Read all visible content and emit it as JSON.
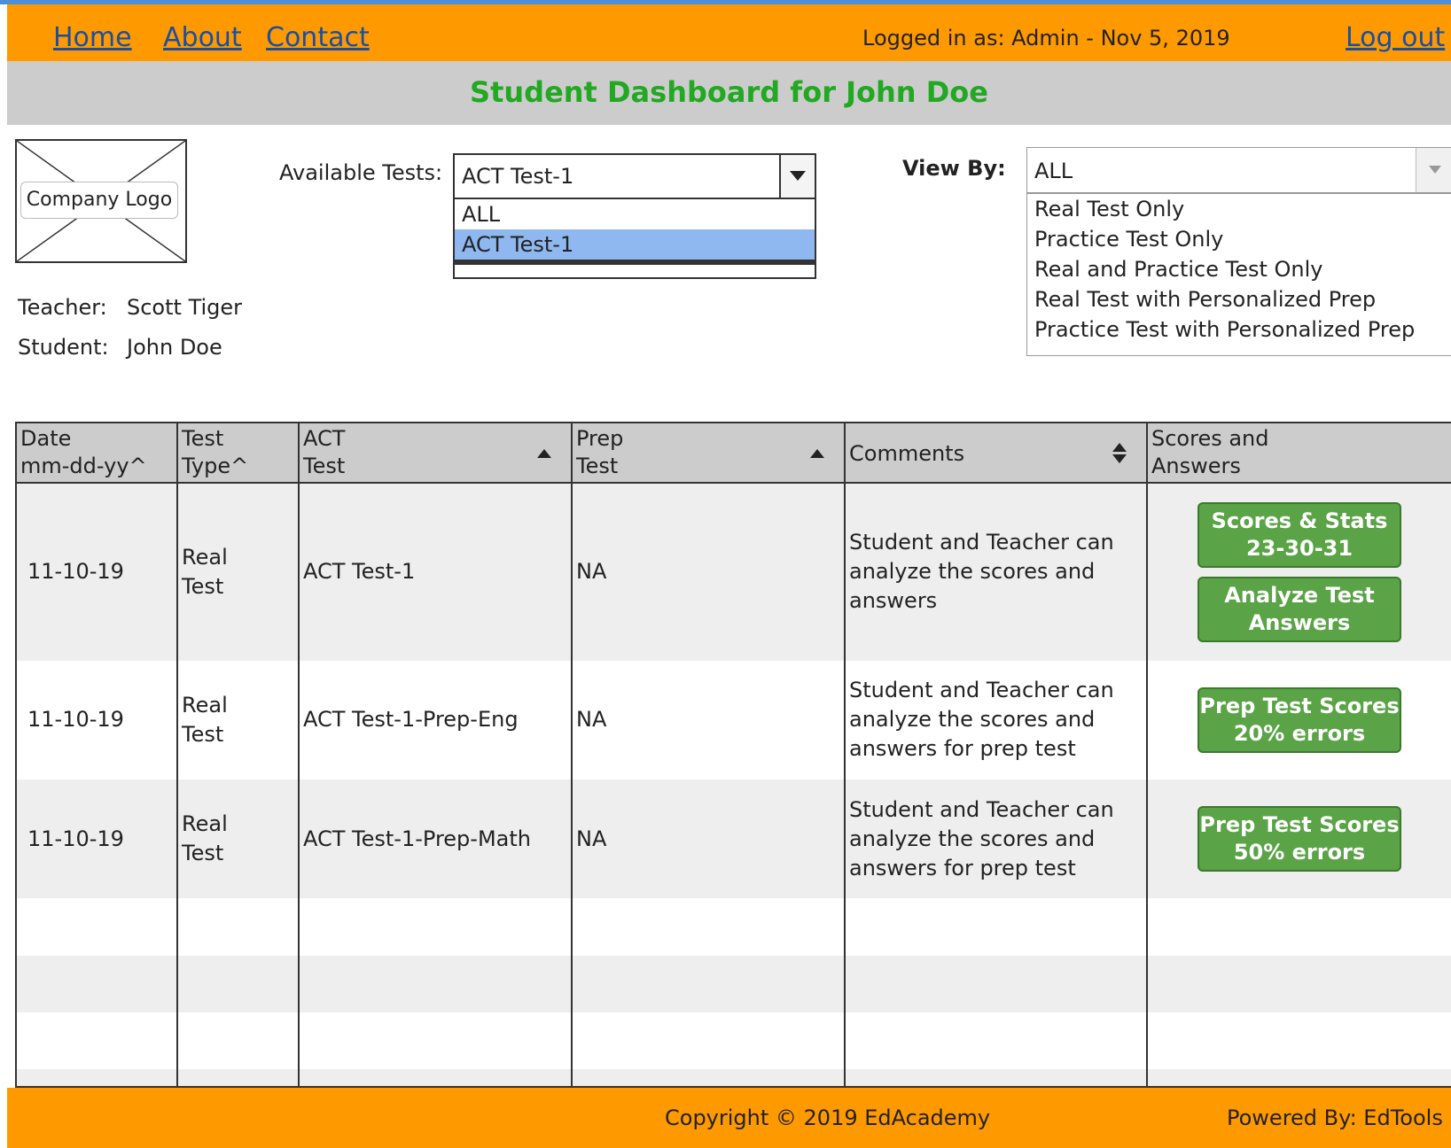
{
  "nav": {
    "home": "Home",
    "about": "About",
    "contact": "Contact",
    "logged_in": "Logged in as: Admin - Nov 5, 2019",
    "logout": "Log out"
  },
  "page_title": "Student Dashboard for John Doe",
  "logo_label": "Company Logo",
  "info": {
    "teacher_label": "Teacher:",
    "teacher_name": "Scott Tiger",
    "student_label": "Student:",
    "student_name": "John Doe"
  },
  "available_tests": {
    "label": "Available Tests:",
    "selected": "ACT Test-1",
    "options": [
      "ALL",
      "ACT Test-1"
    ]
  },
  "view_by": {
    "label": "View By:",
    "selected": "ALL",
    "options": [
      "Real Test Only",
      "Practice Test Only",
      "Real and Practice Test Only",
      "Real Test with Personalized Prep",
      "Practice Test with Personalized Prep"
    ]
  },
  "table": {
    "headers": {
      "date_1": "Date",
      "date_2": "mm-dd-yy^",
      "type_1": "Test",
      "type_2": "Type^",
      "act_1": "ACT",
      "act_2": "Test",
      "prep_1": "Prep",
      "prep_2": "Test",
      "comments": "Comments",
      "scores_1": "Scores and",
      "scores_2": "Answers"
    },
    "rows": [
      {
        "date": "11-10-19",
        "type_1": "Real",
        "type_2": "Test",
        "act_test": "ACT Test-1",
        "prep_test": "NA",
        "comment_1": "Student and Teacher can",
        "comment_2": "analyze the scores and",
        "comment_3": "answers",
        "btn1_l1": "Scores & Stats",
        "btn1_l2": "23-30-31",
        "btn2_l1": "Analyze Test",
        "btn2_l2": "Answers"
      },
      {
        "date": "11-10-19",
        "type_1": "Real",
        "type_2": "Test",
        "act_test": "ACT Test-1-Prep-Eng",
        "prep_test": "NA",
        "comment_1": "Student and Teacher can",
        "comment_2": "analyze the scores and",
        "comment_3": "answers for prep test",
        "btn1_l1": "Prep Test Scores",
        "btn1_l2": "20% errors"
      },
      {
        "date": "11-10-19",
        "type_1": "Real",
        "type_2": "Test",
        "act_test": "ACT Test-1-Prep-Math",
        "prep_test": "NA",
        "comment_1": "Student and Teacher can",
        "comment_2": "analyze the scores and",
        "comment_3": "answers for prep test",
        "btn1_l1": "Prep Test Scores",
        "btn1_l2": "50% errors"
      }
    ]
  },
  "footer": {
    "copyright": "Copyright © 2019 EdAcademy",
    "powered_by": "Powered By: EdTools"
  },
  "colors": {
    "header_bg": "#ff9900",
    "title_green": "#22a822",
    "button_green": "#5aa346",
    "selected_option": "#8fb8f0"
  }
}
